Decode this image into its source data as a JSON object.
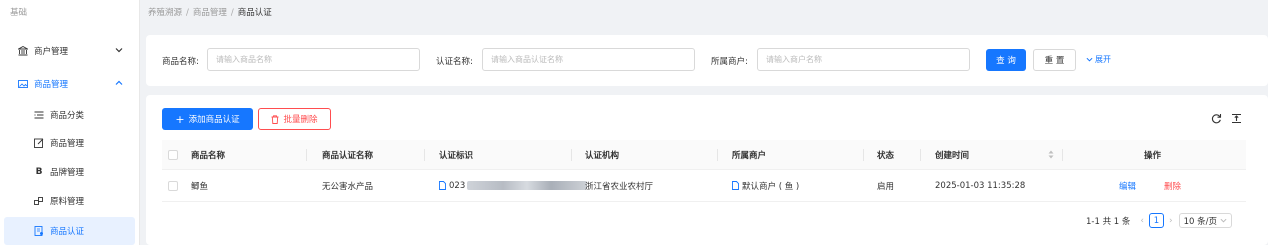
{
  "sidebar": {
    "top_label": "基础",
    "items": [
      {
        "label": "商户管理",
        "icon": "bank-icon"
      },
      {
        "label": "商品管理",
        "icon": "picture-icon"
      },
      {
        "label": "商品分类",
        "icon": "list-icon"
      },
      {
        "label": "商品管理",
        "icon": "edit-icon"
      },
      {
        "label": "品牌管理",
        "icon": "brand-b-icon"
      },
      {
        "label": "原料管理",
        "icon": "material-icon"
      },
      {
        "label": "商品认证",
        "icon": "certificate-icon"
      }
    ]
  },
  "breadcrumb": {
    "items": [
      "养殖溯源",
      "商品管理",
      "商品认证"
    ]
  },
  "search": {
    "product_name_label": "商品名称:",
    "product_name_placeholder": "请输入商品名称",
    "cert_name_label": "认证名称:",
    "cert_name_placeholder": "请输入商品认证名称",
    "merchant_label": "所属商户:",
    "merchant_placeholder": "请输入商户名称",
    "query_label": "查 询",
    "reset_label": "重 置",
    "expand_label": "展开"
  },
  "toolbar": {
    "add_label": "添加商品认证",
    "batch_delete_label": "批量删除"
  },
  "table": {
    "columns": [
      "商品名称",
      "商品认证名称",
      "认证标识",
      "认证机构",
      "所属商户",
      "状态",
      "创建时间",
      "操作"
    ],
    "rows": [
      {
        "product_name": "鲫鱼",
        "cert_name": "无公害水产品",
        "cert_id_prefix": "023",
        "agency": "浙江省农业农村厅",
        "merchant": "默认商户 ( 鱼 )",
        "status": "启用",
        "created": "2025-01-03 11:35:28",
        "edit": "编辑",
        "delete": "删除"
      }
    ]
  },
  "pagination": {
    "summary": "1-1 共 1 条",
    "current_page": "1",
    "page_size": "10 条/页"
  },
  "colors": {
    "primary": "#1677ff",
    "danger": "#ff4d4f"
  }
}
